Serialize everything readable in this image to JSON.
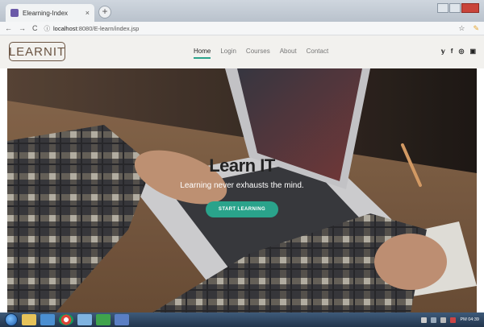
{
  "browser": {
    "tab_title": "Elearning-Index",
    "tab_close": "×",
    "new_tab": "+",
    "url_host": "localhost",
    "url_path": ":8080/E-learn/index.jsp"
  },
  "icons": {
    "back": "←",
    "forward": "→",
    "reload": "C",
    "info": "ⓘ",
    "star": "☆",
    "extension": "✎"
  },
  "nav": {
    "logo": "LEARNIT",
    "items": [
      "Home",
      "Login",
      "Courses",
      "About",
      "Contact"
    ],
    "active": "Home",
    "social": [
      "𝕪",
      "f",
      "◎",
      "▣"
    ]
  },
  "hero": {
    "title": "Learn IT",
    "subtitle": "Learning never exhausts the mind.",
    "cta": "START LEARNING"
  },
  "taskbar": {
    "time": "PM 04:39"
  },
  "colors": {
    "accent": "#2aa38b",
    "logo": "#6a5341",
    "nav_bg": "#f2f1ee"
  }
}
